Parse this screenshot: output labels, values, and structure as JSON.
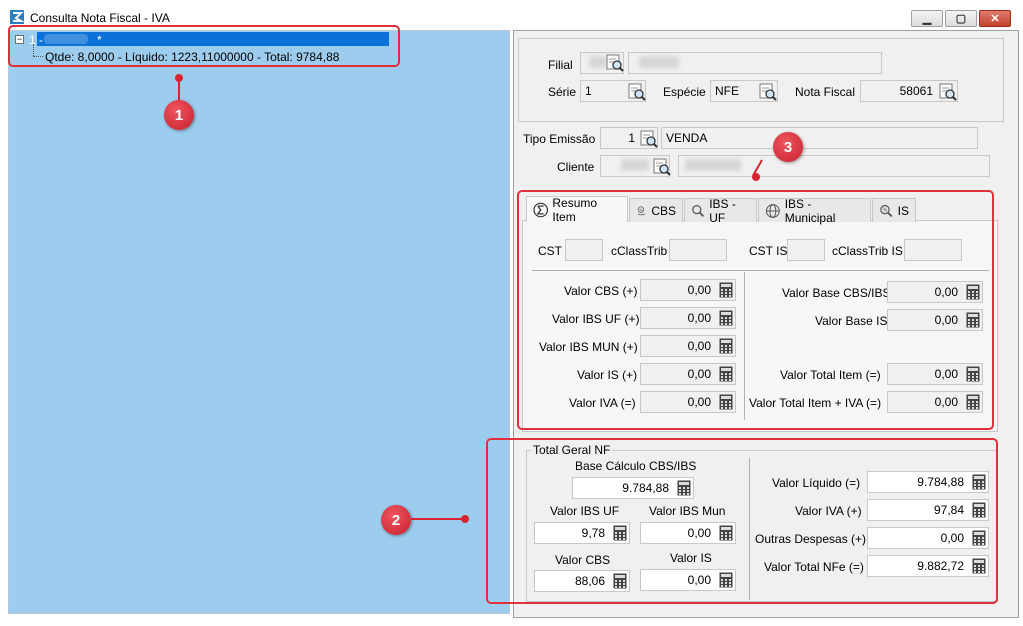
{
  "window": {
    "title": "Consulta Nota Fiscal - IVA"
  },
  "tree": {
    "item_label": "1 -",
    "item_mark": "*",
    "child_label": "Qtde: 8,0000 - Líquido: 1223,11000000 - Total: 9784,88"
  },
  "annotations": {
    "badge1": "1",
    "badge2": "2",
    "badge3": "3"
  },
  "header": {
    "filial_label": "Filial",
    "serie_label": "Série",
    "serie_value": "1",
    "especie_label": "Espécie",
    "especie_value": "NFE",
    "nota_fiscal_label": "Nota Fiscal",
    "nota_fiscal_value": "58061",
    "tipo_emissao_label": "Tipo Emissão",
    "tipo_emissao_code": "1",
    "tipo_emissao_desc": "VENDA",
    "cliente_label": "Cliente"
  },
  "tabs": [
    {
      "label": "Resumo Item",
      "icon": "sigma-icon"
    },
    {
      "label": "CBS",
      "icon": "percent-hand-icon"
    },
    {
      "label": "IBS - UF",
      "icon": "magnifier-icon"
    },
    {
      "label": "IBS - Municipal",
      "icon": "globe-icon"
    },
    {
      "label": "IS",
      "icon": "search-percent-icon"
    }
  ],
  "resumo": {
    "cst_label": "CST",
    "cclasstrib_label": "cClassTrib",
    "cst_is_label": "CST IS",
    "cclasstrib_is_label": "cClassTrib IS",
    "valor_cbs_label": "Valor CBS (+)",
    "valor_cbs": "0,00",
    "valor_ibs_uf_label": "Valor IBS UF (+)",
    "valor_ibs_uf": "0,00",
    "valor_ibs_mun_label": "Valor IBS MUN (+)",
    "valor_ibs_mun": "0,00",
    "valor_is_label": "Valor IS (+)",
    "valor_is": "0,00",
    "valor_iva_label": "Valor IVA (=)",
    "valor_iva": "0,00",
    "valor_base_cbs_ibs_label": "Valor Base CBS/IBS",
    "valor_base_cbs_ibs": "0,00",
    "valor_base_is_label": "Valor Base IS",
    "valor_base_is": "0,00",
    "valor_total_item_label": "Valor Total Item (=)",
    "valor_total_item": "0,00",
    "valor_total_item_iva_label": "Valor Total Item + IVA (=)",
    "valor_total_item_iva": "0,00"
  },
  "total_geral": {
    "legend": "Total Geral NF",
    "base_calculo_label": "Base Cálculo CBS/IBS",
    "base_calculo": "9.784,88",
    "valor_ibs_uf_label": "Valor IBS UF",
    "valor_ibs_uf": "9,78",
    "valor_ibs_mun_label": "Valor IBS Mun",
    "valor_ibs_mun": "0,00",
    "valor_cbs_label": "Valor CBS",
    "valor_cbs": "88,06",
    "valor_is_label": "Valor IS",
    "valor_is": "0,00",
    "valor_liquido_label": "Valor Líquido (=)",
    "valor_liquido": "9.784,88",
    "valor_iva_label": "Valor IVA (+)",
    "valor_iva": "97,84",
    "outras_despesas_label": "Outras Despesas (+)",
    "outras_despesas": "0,00",
    "valor_total_nfe_label": "Valor Total NFe (=)",
    "valor_total_nfe": "9.882,72"
  },
  "colors": {
    "tree_bg": "#9dcdee",
    "selection": "#0a72d8",
    "annotation": "#d8242e"
  }
}
